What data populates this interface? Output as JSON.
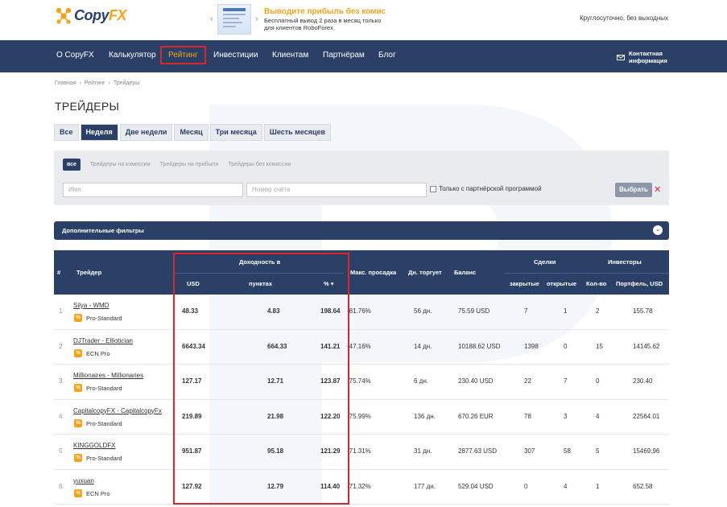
{
  "header": {
    "logo_text_1": "Copy",
    "logo_text_2": "FX",
    "promo": {
      "prev": "‹",
      "next": "›",
      "title": "Выводите прибыль без комиссии",
      "subtitle": "Бесплатный вывод 2 раза в месяц только для клиентов RoboForex."
    },
    "hours": "Круглосуточно, без выходных"
  },
  "nav": {
    "items": [
      "О CopyFX",
      "Калькулятор",
      "Рейтинг",
      "Инвестиции",
      "Клиентам",
      "Партнёрам",
      "Блог"
    ],
    "active": "Рейтинг",
    "contact_line1": "Контактная",
    "contact_line2": "информация"
  },
  "breadcrumb": [
    "Главная",
    "›",
    "Рейтинг",
    "›",
    "Трейдеры"
  ],
  "page_title": "ТРЕЙДЕРЫ",
  "period_tabs": [
    "Все",
    "Неделя",
    "Две недели",
    "Месяц",
    "Три месяца",
    "Шесть месяцев"
  ],
  "period_active": "Неделя",
  "filters": {
    "subtabs": [
      "все",
      "Трейдеры на комиссии",
      "Трейдеры на прибыли",
      "Трейдеры без комиссии"
    ],
    "name_placeholder": "Имя",
    "account_placeholder": "Номер счёта",
    "partner_checkbox": "Только с партнёрской программой",
    "choose_button": "Выбрать",
    "clear_icon": "✕"
  },
  "advanced_filters": "Дополнительные фильтры",
  "table": {
    "headers": {
      "num": "#",
      "trader": "Трейдер",
      "profit_group": "Доходность в",
      "usd": "USD",
      "points": "пунктах",
      "pct": "%",
      "drawdown": "Макс. просадка",
      "days": "Дн. торгует",
      "balance": "Баланс",
      "deals_group": "Сделки",
      "closed": "закрытые",
      "open": "открытые",
      "investors_group": "Инвесторы",
      "inv_count": "Кол-во",
      "portfolio": "Портфель, USD"
    },
    "rows": [
      {
        "n": "1",
        "name": "Silya - WMD",
        "acct": "Pro-Standard",
        "usd": "48.33",
        "points": "4.83",
        "pct": "198.64",
        "dd": "-81.76%",
        "days": "56 дн.",
        "balance": "75.59 USD",
        "closed": "7",
        "open": "1",
        "inv": "2",
        "portfolio": "155.78"
      },
      {
        "n": "2",
        "name": "DJTrader - Elliotician",
        "acct": "ECN Pro",
        "usd": "6643.34",
        "points": "664.33",
        "pct": "141.21",
        "dd": "-47.16%",
        "days": "14 дн.",
        "balance": "10188.62 USD",
        "closed": "1398",
        "open": "0",
        "inv": "15",
        "portfolio": "14145.62"
      },
      {
        "n": "3",
        "name": "Millionaires - Millionaries",
        "acct": "Pro-Standard",
        "usd": "127.17",
        "points": "12.71",
        "pct": "123.87",
        "dd": "-75.74%",
        "days": "6 дн.",
        "balance": "230.40 USD",
        "closed": "22",
        "open": "7",
        "inv": "0",
        "portfolio": "230.40"
      },
      {
        "n": "4",
        "name": "CapitalcopyFX - CapitalcopyFx",
        "acct": "Pro-Standard",
        "usd": "219.89",
        "points": "21.98",
        "pct": "122.20",
        "dd": "-75.99%",
        "days": "136 дн.",
        "balance": "670.26 EUR",
        "closed": "78",
        "open": "3",
        "inv": "4",
        "portfolio": "22564.01"
      },
      {
        "n": "5",
        "name": "KINGGOLDFX",
        "acct": "Pro-Standard",
        "usd": "951.87",
        "points": "95.18",
        "pct": "121.29",
        "dd": "-71.31%",
        "days": "31 дн.",
        "balance": "2877.63 USD",
        "closed": "307",
        "open": "58",
        "inv": "5",
        "portfolio": "15469.96"
      },
      {
        "n": "6",
        "name": "yuxuan",
        "acct": "ECN Pro",
        "usd": "127.92",
        "points": "12.79",
        "pct": "114.40",
        "dd": "-71.32%",
        "days": "177 дн.",
        "balance": "529.04 USD",
        "closed": "0",
        "open": "4",
        "inv": "1",
        "portfolio": "652.58"
      }
    ]
  },
  "colors": {
    "brand_navy": "#2b4066",
    "brand_orange": "#f5a31a",
    "highlight_red": "#d9262c"
  },
  "icons": {
    "logo": "copyfx-logo-icon",
    "promo_thumb": "promo-thumb-icon",
    "contact": "envelope-icon",
    "sort": "sort-down-icon",
    "badge": "percent-badge-icon",
    "chevron": "chevron-down-icon",
    "badge_glyph": "%",
    "sort_glyph": "▾",
    "chevron_glyph": "⌄"
  }
}
